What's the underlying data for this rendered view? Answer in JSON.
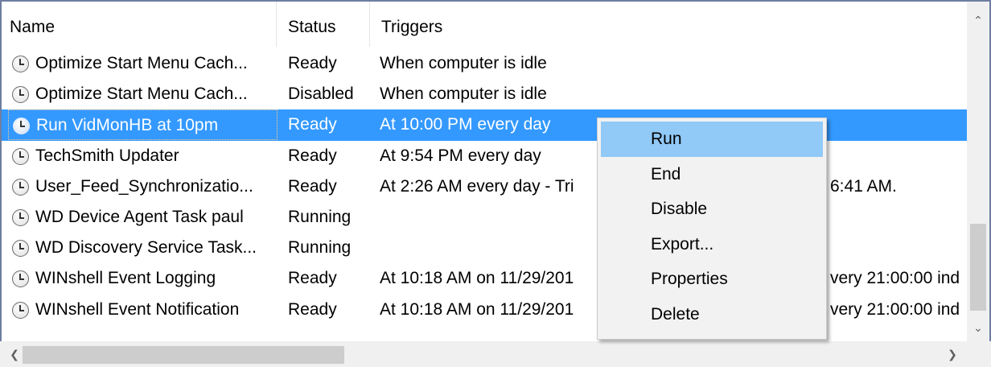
{
  "columns": {
    "name": "Name",
    "status": "Status",
    "triggers": "Triggers"
  },
  "rows": [
    {
      "name": "Optimize Start Menu Cach...",
      "status": "Ready",
      "triggers": "When computer is idle"
    },
    {
      "name": "Optimize Start Menu Cach...",
      "status": "Disabled",
      "triggers": "When computer is idle"
    },
    {
      "name": "Run VidMonHB at 10pm",
      "status": "Ready",
      "triggers": "At 10:00 PM every day",
      "selected": true
    },
    {
      "name": "TechSmith Updater",
      "status": "Ready",
      "triggers": "At 9:54 PM every day"
    },
    {
      "name": "User_Feed_Synchronizatio...",
      "status": "Ready",
      "triggers": "At 2:26 AM every day - Tri",
      "triggers_tail": "6:41 AM."
    },
    {
      "name": "WD Device Agent Task paul",
      "status": "Running",
      "triggers": ""
    },
    {
      "name": "WD Discovery Service Task...",
      "status": "Running",
      "triggers": ""
    },
    {
      "name": "WINshell Event Logging",
      "status": "Ready",
      "triggers": "At 10:18 AM on 11/29/201",
      "triggers_tail": "very 21:00:00 ind"
    },
    {
      "name": "WINshell Event Notification",
      "status": "Ready",
      "triggers": "At 10:18 AM on 11/29/201",
      "triggers_tail": "very 21:00:00 ind"
    }
  ],
  "context_menu": {
    "items": [
      "Run",
      "End",
      "Disable",
      "Export...",
      "Properties",
      "Delete"
    ],
    "hovered": "Run"
  },
  "icons": {
    "row_icon": "task-clock-icon",
    "scroll_up": "chevron-up-icon",
    "scroll_down": "chevron-down-icon",
    "scroll_left": "chevron-left-icon",
    "scroll_right": "chevron-right-icon"
  },
  "colors": {
    "selection": "#3399ff",
    "menu_hover": "#91c9f7",
    "menu_background": "#f2f2f2",
    "frame_border": "#6d7ea0"
  }
}
